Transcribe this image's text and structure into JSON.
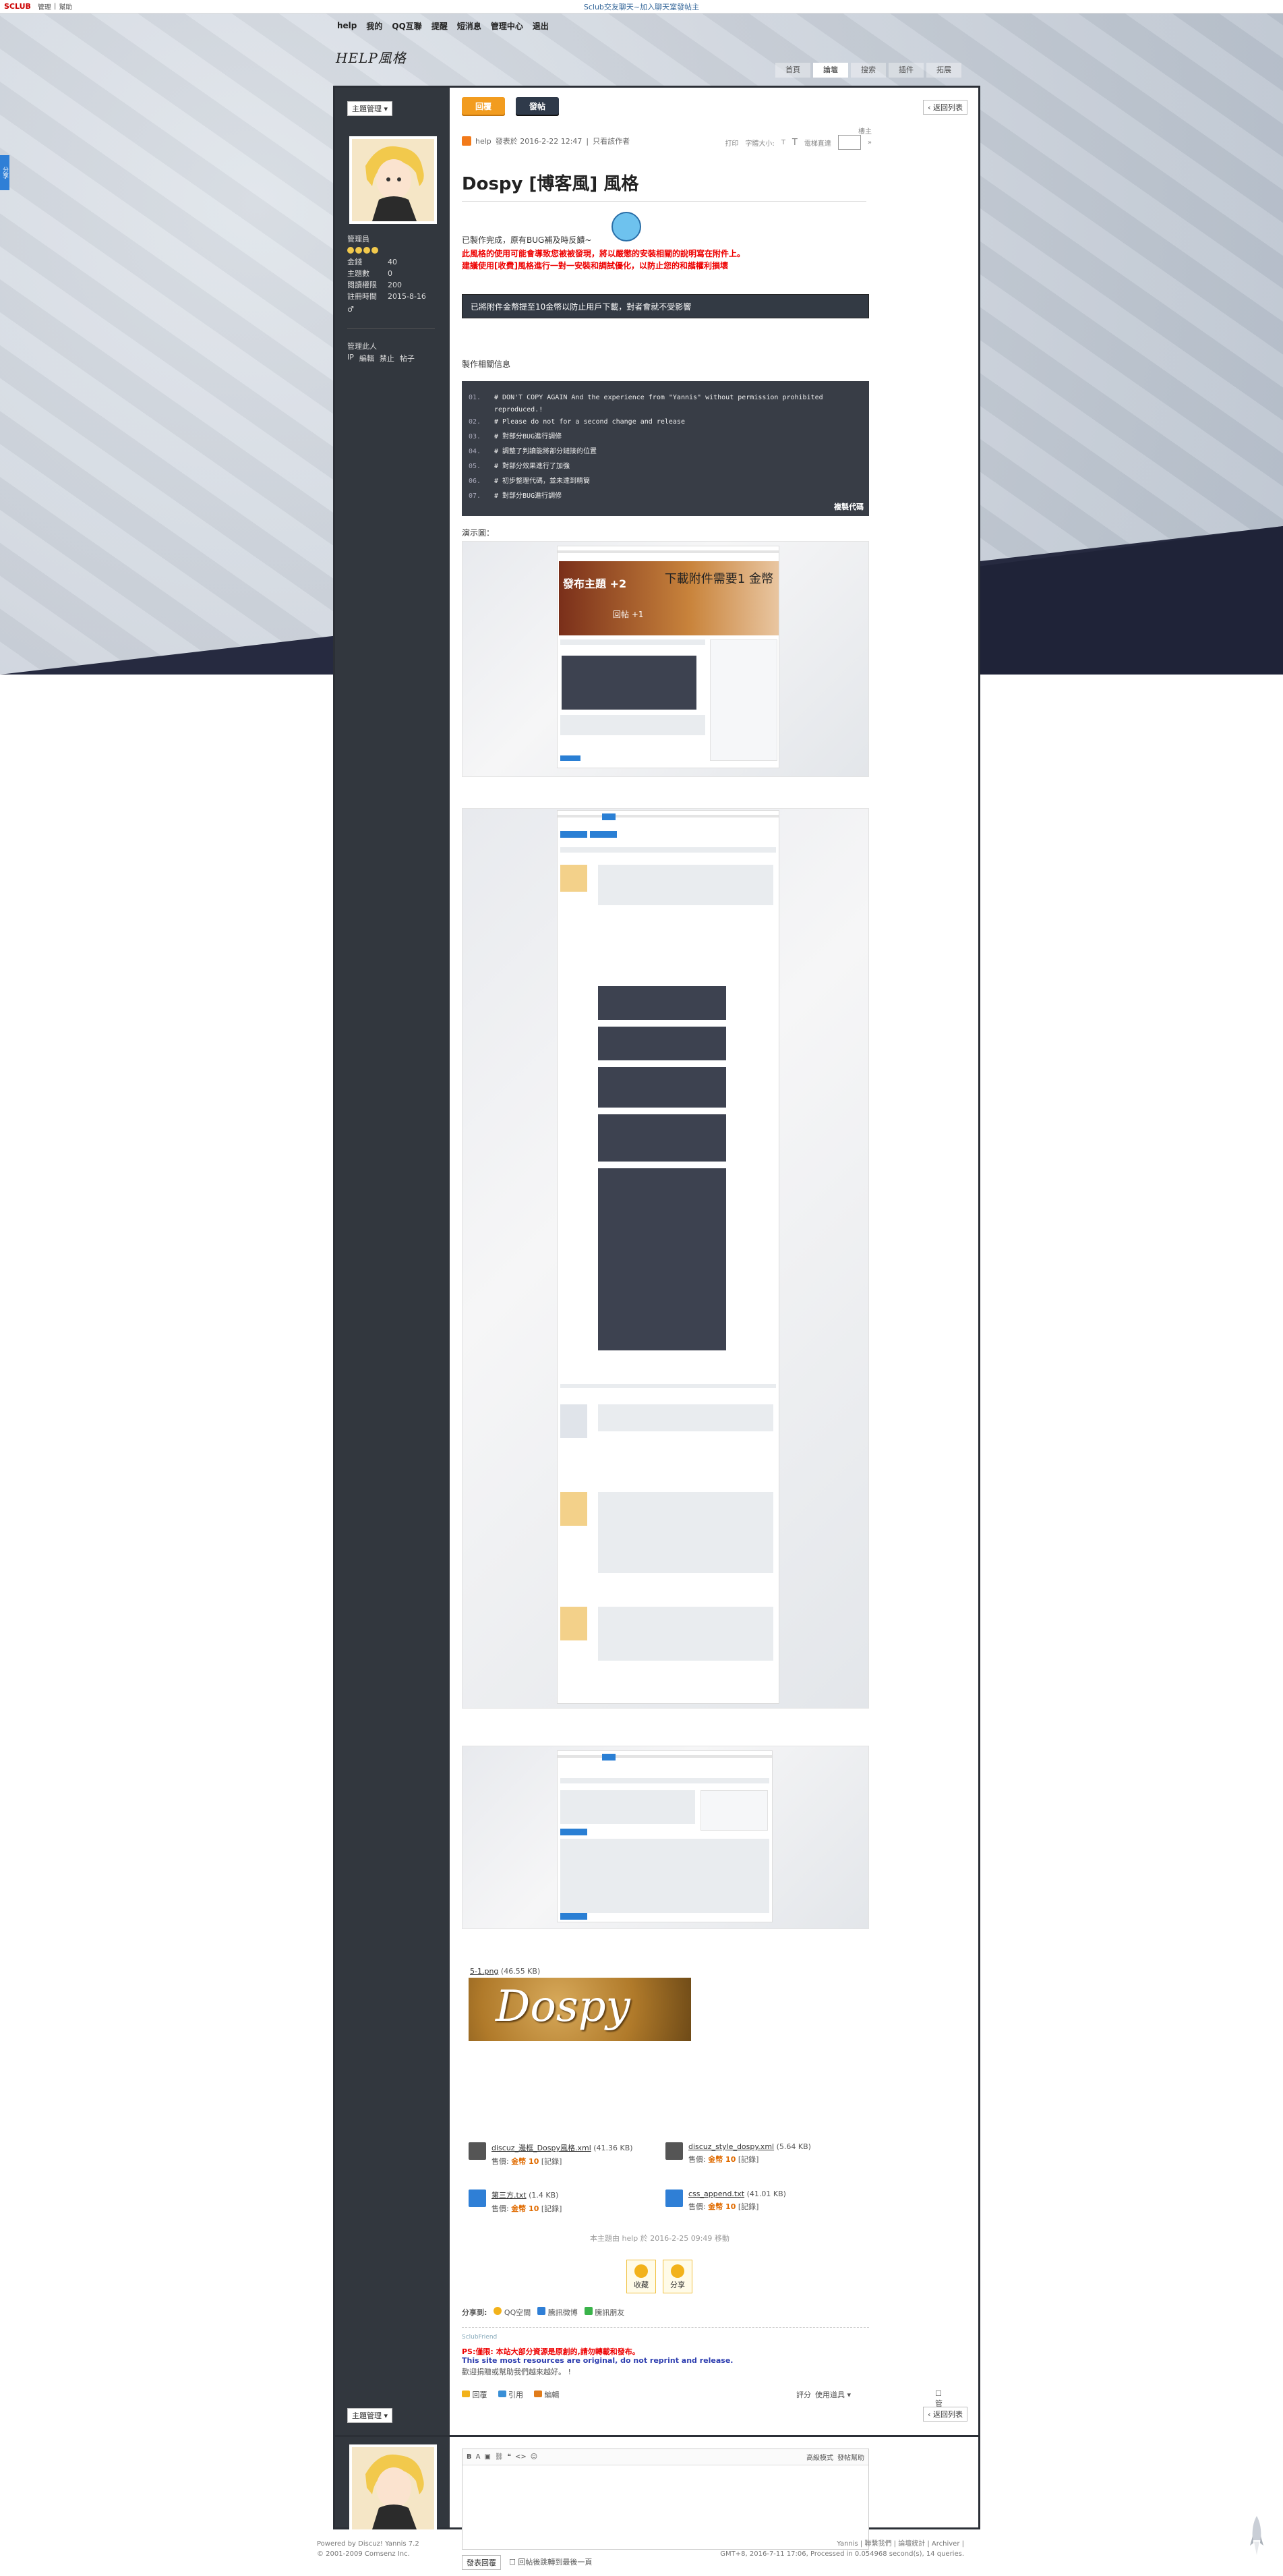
{
  "topbar": {
    "logo": "SCLUB",
    "links": [
      "管理",
      "|",
      "幫助"
    ],
    "center_text": "Sclub交友聊天~加入聊天室發帖主"
  },
  "mainnav": [
    "help",
    "我的",
    "QQ互聯",
    "提醒",
    "短消息",
    "管理中心",
    "退出"
  ],
  "logo_text": "HELP風格",
  "subnav": [
    "首頁",
    "論壇",
    "搜索",
    "插件",
    "拓展"
  ],
  "sidetab": "分享",
  "toolbar": {
    "manage_label": "主題管理",
    "back_label": "返回列表",
    "post_label": "發帖",
    "reply_label": "回覆"
  },
  "author": {
    "role": "管理員",
    "stats": [
      {
        "k": "金錢",
        "v": "40"
      },
      {
        "k": "主題數",
        "v": "0"
      },
      {
        "k": "閱讀權限",
        "v": "200"
      },
      {
        "k": "註冊時間",
        "v": "2015-8-16"
      }
    ],
    "admin_title": "管理此人",
    "admin_links": [
      "IP",
      "編輯",
      "禁止",
      "帖子"
    ]
  },
  "post": {
    "author": "help",
    "posted": "發表於 2016-2-22 12:47",
    "only_author": "只看該作者",
    "tools": [
      "打印",
      "字體大小:",
      "T",
      "T",
      "電梯直達",
      "樓主"
    ],
    "title": "Dospy [博客風] 風格",
    "intro": "已製作完成，原有BUG補及時反饋~",
    "warn1": "此風格的使用可能會導致您被被發現，將以嚴懲的安裝相關的說明寫在附件上。",
    "warn2": "建議使用[收費]風格進行一對一安裝和調試優化，以防止您的和諧權利損壞",
    "notice": "已將附件金幣提至10金幣以防止用戶下載，對者會就不受影響",
    "info_title": "製作相關信息",
    "code_lines": [
      {
        "n": "01.",
        "t": "# DON'T COPY AGAIN And the experience from \"Yannis\" without permission prohibited"
      },
      {
        "n": "",
        "t": "reproduced.!"
      },
      {
        "n": "02.",
        "t": "# Please do not for a second change and release"
      },
      {
        "n": "03.",
        "t": "# 對部分BUG進行調修"
      },
      {
        "n": "04.",
        "t": "# 調整了判讀能將部分鏈接的位置"
      },
      {
        "n": "05.",
        "t": "# 對部分效果進行了加強"
      },
      {
        "n": "06.",
        "t": "# 初步整理代碼，並未達到精簡"
      },
      {
        "n": "07.",
        "t": "# 對部分BUG進行調修"
      }
    ],
    "copy_label": "複製代碼",
    "demo_label": "演示圖：",
    "shot1": {
      "banner_text": "發布主題 +2",
      "banner_text2": "下載附件需要1 金幣",
      "banner_text3": "回帖 +1"
    },
    "banner_file": "5-1.png",
    "banner_size": "(46.55 KB)",
    "banner_text": "Dospy",
    "attachments": [
      {
        "name": "discuz_邊框_Dospy風格.xml",
        "size": "(41.36 KB)",
        "price_label": "售價:",
        "price": "金幣 10",
        "buy": "[記錄]"
      },
      {
        "name": "discuz_style_dospy.xml",
        "size": "(5.64 KB)",
        "price_label": "售價:",
        "price": "金幣 10",
        "buy": "[記錄]"
      },
      {
        "name": "第三方.txt",
        "size": "(1.4 KB)",
        "price_label": "售價:",
        "price": "金幣 10",
        "buy": "[記錄]"
      },
      {
        "name": "css_append.txt",
        "size": "(41.01 KB)",
        "price_label": "售價:",
        "price": "金幣 10",
        "buy": "[記錄]"
      }
    ],
    "edited": "本主題由 help 於 2016-2-25 09:49 移動",
    "actions": [
      "收藏",
      "分享"
    ],
    "share_title": "分享到:",
    "share_items": [
      "QQ空間",
      "騰訊微博",
      "騰訊朋友"
    ],
    "sig_small": "SclubFriend",
    "sig_line1": "PS:僅限: 本站大部分資源是原創的,請勿轉載和發布。",
    "sig_line2": "This site most resources are original, do not reprint and release.",
    "sig_line3": "歡迎捐贈或幫助我們越來越好。 !",
    "footer_actions": [
      "回覆",
      "引用",
      "編輯"
    ],
    "rate_label": "評分",
    "use_tool": "使用道具",
    "manage_check": "管理"
  },
  "reply": {
    "toolbar_right": [
      "高級模式",
      "發帖幫助"
    ],
    "submit": "發表回覆",
    "return_check": "回帖後跳轉到最後一頁"
  },
  "footer": {
    "left1": "Powered by Discuz! Yannis 7.2",
    "left2": "© 2001-2009 Comsenz Inc.",
    "right1": "Yannis | 聯繫我們 | 論壇統計 | Archiver |",
    "right2": "GMT+8, 2016-7-11 17:06, Processed in 0.054968 second(s), 14 queries."
  },
  "colors": {
    "accent": "#f29c1f",
    "frame": "#2b2f36",
    "warn": "#e00000",
    "link": "#2f7fd6"
  }
}
